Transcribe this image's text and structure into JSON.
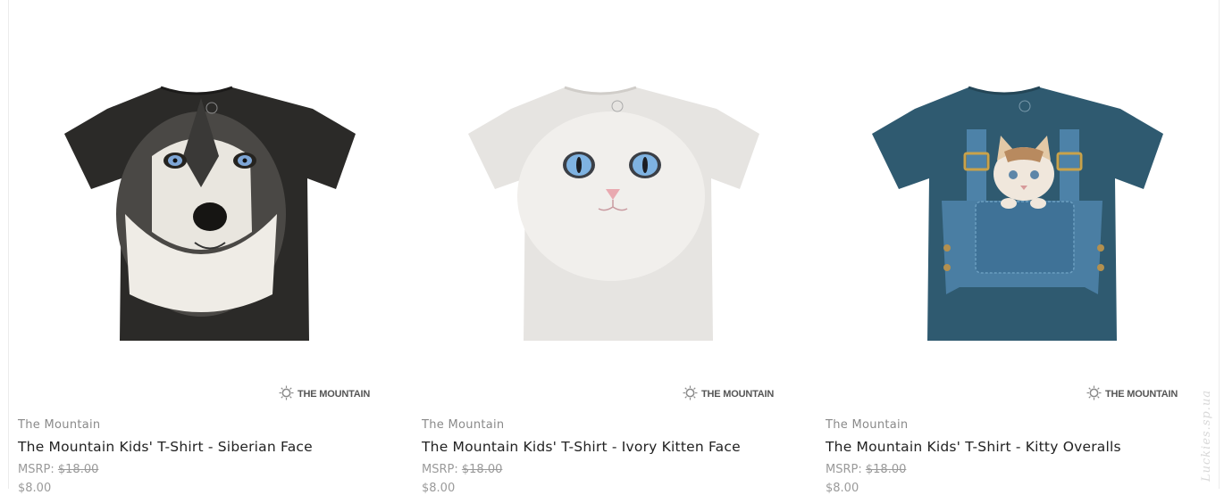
{
  "products": [
    {
      "brand": "The Mountain",
      "title": "The Mountain Kids' T-Shirt - Siberian Face",
      "msrp_label": "MSRP:",
      "msrp_value": "$18.00",
      "price": "$8.00",
      "logo_text": "THE MOUNTAIN",
      "shirt_color": "#2b2a28",
      "image_subject": "siberian-husky-face"
    },
    {
      "brand": "The Mountain",
      "title": "The Mountain Kids' T-Shirt - Ivory Kitten Face",
      "msrp_label": "MSRP:",
      "msrp_value": "$18.00",
      "price": "$8.00",
      "logo_text": "THE MOUNTAIN",
      "shirt_color": "#e6e4e1",
      "image_subject": "ivory-kitten-face"
    },
    {
      "brand": "The Mountain",
      "title": "The Mountain Kids' T-Shirt - Kitty Overalls",
      "msrp_label": "MSRP:",
      "msrp_value": "$18.00",
      "price": "$8.00",
      "logo_text": "THE MOUNTAIN",
      "shirt_color": "#2f5a70",
      "image_subject": "kitten-in-denim-overalls"
    }
  ],
  "watermark": "Luckies.sp.ua"
}
